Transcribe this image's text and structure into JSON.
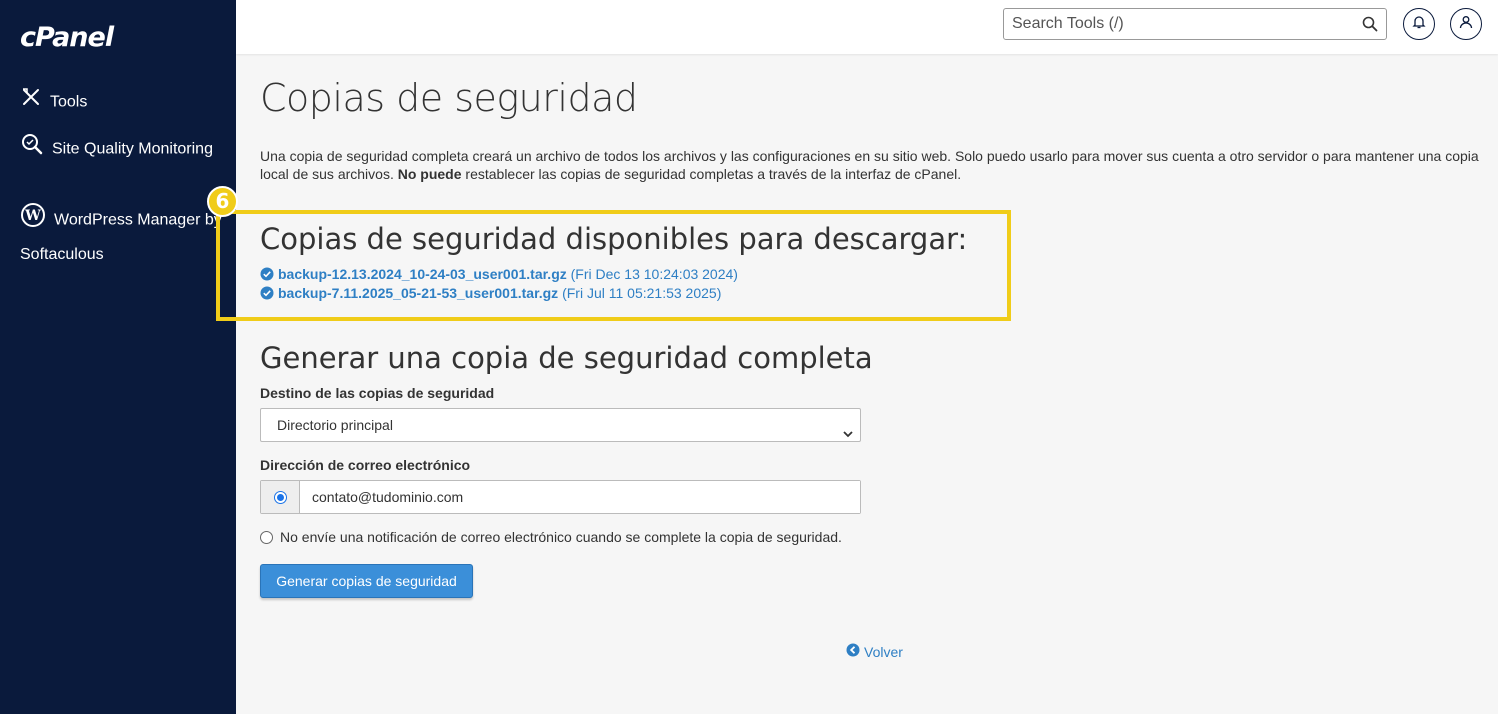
{
  "sidebar": {
    "logo": "cPanel",
    "items": [
      {
        "label": "Tools",
        "icon": "tools-icon"
      },
      {
        "label": "Site Quality Monitoring",
        "icon": "search-quality-icon"
      },
      {
        "label": "WordPress Manager by Softaculous",
        "icon": "wordpress-icon"
      }
    ]
  },
  "header": {
    "search_placeholder": "Search Tools (/)"
  },
  "page": {
    "title": "Copias de seguridad",
    "description_part1": "Una copia de seguridad completa creará un archivo de todos los archivos y las configuraciones en su sitio web. Solo puedo usarlo para mover sus cuenta a otro servidor o para mantener una copia local de sus archivos. ",
    "description_bold": "No puede",
    "description_part2": " restablecer las copias de seguridad completas a través de la interfaz de cPanel.",
    "step_badge": "6"
  },
  "downloads": {
    "heading": "Copias de seguridad disponibles para descargar:",
    "items": [
      {
        "file": "backup-12.13.2024_10-24-03_user001.tar.gz",
        "date": "(Fri Dec 13 10:24:03 2024)"
      },
      {
        "file": "backup-7.11.2025_05-21-53_user001.tar.gz",
        "date": "(Fri Jul 11 05:21:53 2025)"
      }
    ]
  },
  "generate": {
    "heading": "Generar una copia de seguridad completa",
    "destination_label": "Destino de las copias de seguridad",
    "destination_value": "Directorio principal",
    "email_label": "Dirección de correo electrónico",
    "email_value": "contato@tudominio.com",
    "no_notify_label": "No envíe una notificación de correo electrónico cuando se complete la copia de seguridad.",
    "button_label": "Generar copias de seguridad",
    "back_label": "Volver"
  },
  "colors": {
    "sidebar_bg": "#0a1a3c",
    "link": "#2e7fc4",
    "highlight": "#f0cc19",
    "button": "#3b8fd9"
  }
}
